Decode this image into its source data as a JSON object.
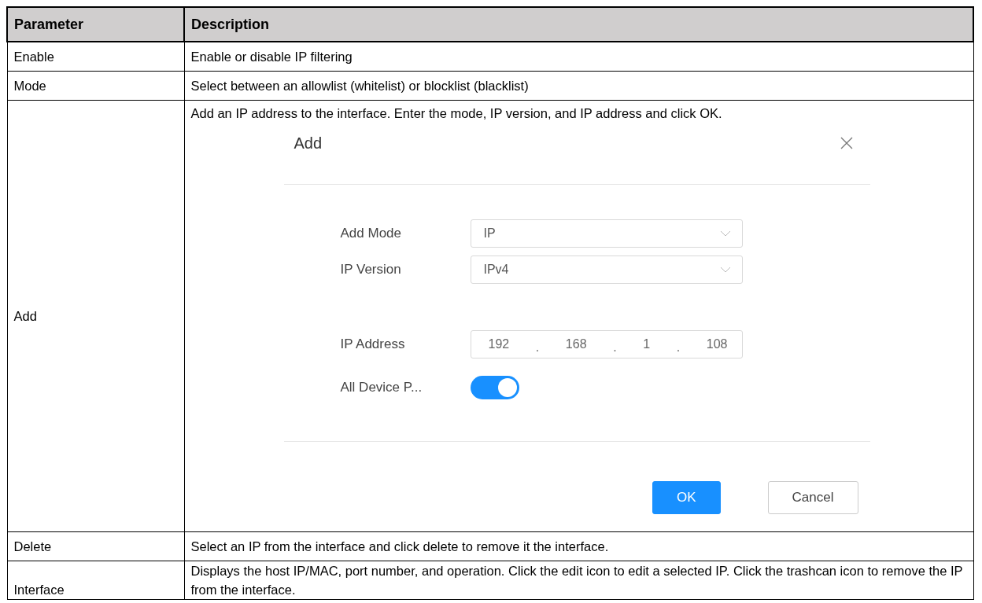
{
  "table": {
    "columns": [
      "Parameter",
      "Description"
    ],
    "rows": [
      {
        "parameter": "Enable",
        "description": "Enable or disable IP filtering"
      },
      {
        "parameter": "Mode",
        "description": "Select between an allowlist (whitelist) or blocklist (blacklist)"
      },
      {
        "parameter": "Add",
        "description": "Add an IP address to the interface. Enter the mode, IP version, and IP address and click OK.",
        "dialog": {
          "title": "Add",
          "fields": [
            {
              "kind": "select",
              "label": "Add Mode",
              "value": "IP"
            },
            {
              "kind": "select",
              "label": "IP Version",
              "value": "IPv4"
            },
            {
              "kind": "ip",
              "label": "IP Address",
              "octets": [
                "192",
                "168",
                "1",
                "108"
              ],
              "separator": "."
            },
            {
              "kind": "toggle",
              "label": "All Device P...",
              "on": true
            }
          ],
          "buttons": [
            {
              "label": "OK",
              "primary": true
            },
            {
              "label": "Cancel",
              "primary": false
            }
          ]
        }
      },
      {
        "parameter": "Delete",
        "description": "Select an IP from the interface and click delete to remove it the interface."
      },
      {
        "parameter": "Interface",
        "description": "Displays the host IP/MAC, port number, and operation. Click the edit icon to edit a selected IP. Click the trashcan icon to remove the IP from the interface."
      }
    ]
  }
}
